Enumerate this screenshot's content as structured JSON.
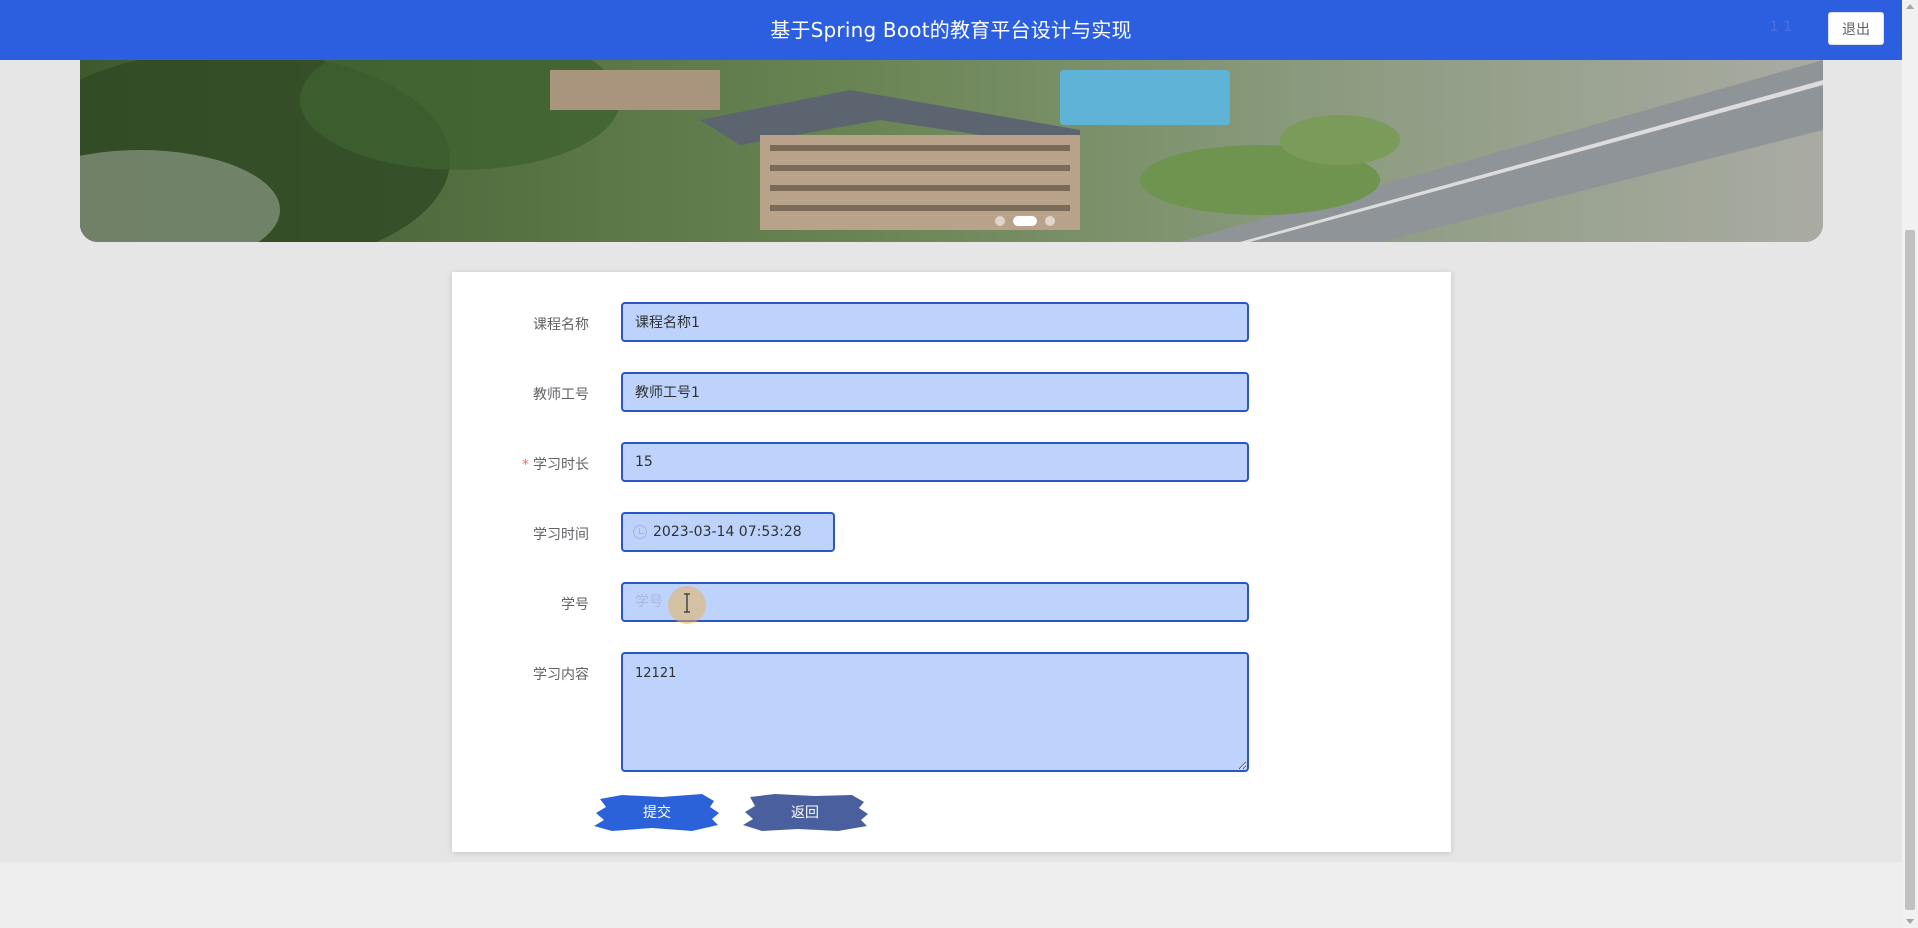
{
  "header": {
    "title": "基于Spring Boot的教育平台设计与实现",
    "user_text": "1 1",
    "logout_label": "退出"
  },
  "carousel": {
    "slides": 3,
    "active_index": 1
  },
  "form": {
    "fields": [
      {
        "label": "课程名称",
        "value": "课程名称1",
        "placeholder": "",
        "required": false
      },
      {
        "label": "教师工号",
        "value": "教师工号1",
        "placeholder": "",
        "required": false
      },
      {
        "label": "学习时长",
        "value": "15",
        "placeholder": "",
        "required": true,
        "required_mark": "*"
      },
      {
        "label": "学习时间",
        "value": "2023-03-14 07:53:28",
        "placeholder": "",
        "required": false
      },
      {
        "label": "学号",
        "value": "",
        "placeholder": "学号",
        "required": false
      },
      {
        "label": "学习内容",
        "value": "12121",
        "placeholder": "",
        "required": false
      }
    ],
    "submit_label": "提交",
    "back_label": "返回"
  },
  "colors": {
    "header_bg": "#2b5fe0",
    "input_bg": "#bed3fb",
    "input_border": "#2a56c8",
    "submit_bg": "#2b62d9",
    "back_bg": "#4a609e"
  }
}
